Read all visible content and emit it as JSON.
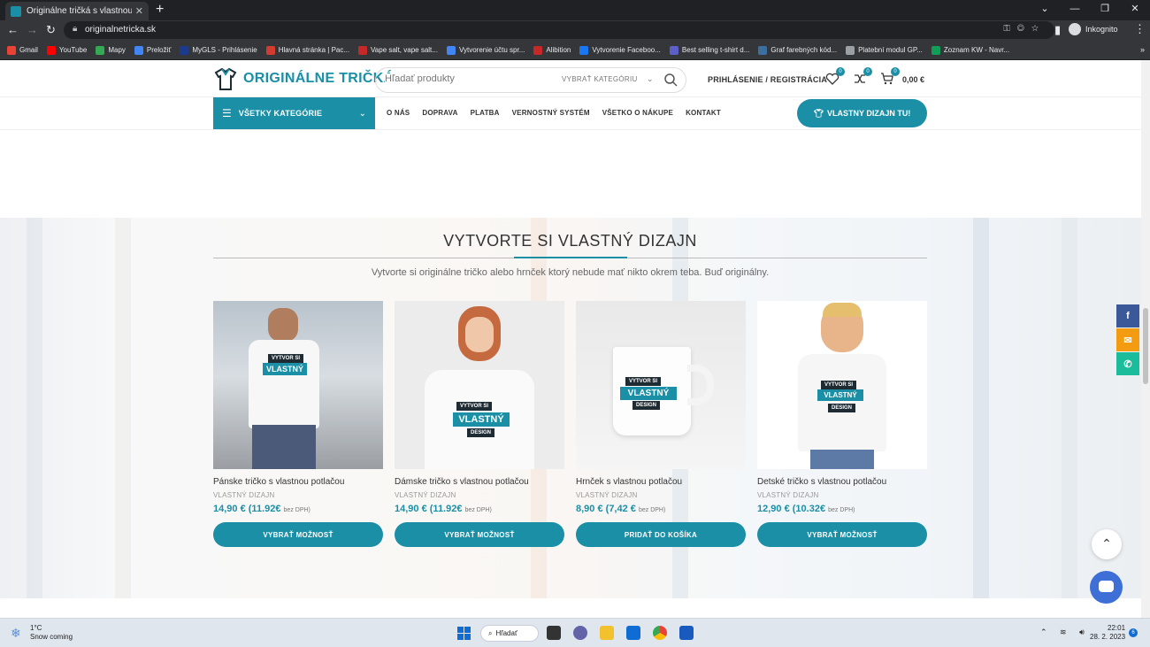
{
  "browser": {
    "tab_title": "Originálne tričká s vlastnou potl...",
    "url": "originalnetricka.sk",
    "profile_label": "Inkognito",
    "bookmarks": [
      {
        "label": "Gmail",
        "color": "#ea4335"
      },
      {
        "label": "YouTube",
        "color": "#ff0000"
      },
      {
        "label": "Mapy",
        "color": "#34a853"
      },
      {
        "label": "Preložiť",
        "color": "#4285f4"
      },
      {
        "label": "MyGLS - Prihlásenie",
        "color": "#1a3b8e"
      },
      {
        "label": "Hlavná stránka | Pac...",
        "color": "#d23b2f"
      },
      {
        "label": "Vape salt, vape salt...",
        "color": "#c62828"
      },
      {
        "label": "Vytvorenie účtu spr...",
        "color": "#4285f4"
      },
      {
        "label": "Alibition",
        "color": "#c62828"
      },
      {
        "label": "Vytvorenie Faceboo...",
        "color": "#1877f2"
      },
      {
        "label": "Best selling t-shirt d...",
        "color": "#5b5fc7"
      },
      {
        "label": "Graf farebných kód...",
        "color": "#3c6e9e"
      },
      {
        "label": "Platební modul GP...",
        "color": "#9aa0a6"
      },
      {
        "label": "Zoznam KW - Navr...",
        "color": "#0f9d58"
      }
    ]
  },
  "site": {
    "logo_text": "ORIGINÁLNE TRIČKÁ",
    "search": {
      "placeholder": "Hľadať produkty",
      "category_label": "VYBRAŤ KATEGÓRIU"
    },
    "login_label": "PRIHLÁSENIE / REGISTRÁCIA",
    "wishlist_count": "0",
    "compare_count": "0",
    "cart_count": "0",
    "cart_total": "0,00 €",
    "all_categories_label": "VŠETKY KATEGÓRIE",
    "menu": [
      "O NÁS",
      "DOPRAVA",
      "PLATBA",
      "VERNOSTNÝ SYSTÉM",
      "VŠETKO O NÁKUPE",
      "KONTAKT"
    ],
    "cta_label": "VLASTNY DIZAJN TU!",
    "accent_color": "#1a8fa6"
  },
  "section": {
    "title": "VYTVORTE SI VLASTNÝ DIZAJN",
    "subtitle": "Vytvorte si originálne tričko alebo hrnček ktorý nebude mať nikto okrem teba. Buď originálny.",
    "products": [
      {
        "name": "Pánske tričko s vlastnou potlačou",
        "category": "VLASTNÝ DIZAJN",
        "price": "14,90 €",
        "price_net": "(11.92€",
        "price_note": "bez DPH)",
        "button": "VYBRAŤ MOŽNOSŤ"
      },
      {
        "name": "Dámske tričko s vlastnou potlačou",
        "category": "VLASTNÝ DIZAJN",
        "price": "14,90 €",
        "price_net": "(11.92€",
        "price_note": "bez DPH)",
        "button": "VYBRAŤ MOŽNOSŤ"
      },
      {
        "name": "Hrnček s vlastnou potlačou",
        "category": "VLASTNÝ DIZAJN",
        "price": "8,90 €",
        "price_net": "(7,42 €",
        "price_note": "bez DPH)",
        "button": "PRIDAŤ DO KOŠÍKA"
      },
      {
        "name": "Detské tričko s vlastnou potlačou",
        "category": "VLASTNÝ DIZAJN",
        "price": "12,90 €",
        "price_net": "(10.32€",
        "price_note": "bez DPH)",
        "button": "VYBRAŤ MOŽNOSŤ"
      }
    ],
    "design_text_1": "VYTVOR SI",
    "design_text_2": "VLASTNÝ",
    "design_text_3": "DESIGN"
  },
  "taskbar": {
    "temperature": "1°C",
    "weather_text": "Snow coming",
    "search_label": "Hľadať",
    "time": "22:01",
    "date": "28. 2. 2023",
    "notifications": "6"
  }
}
